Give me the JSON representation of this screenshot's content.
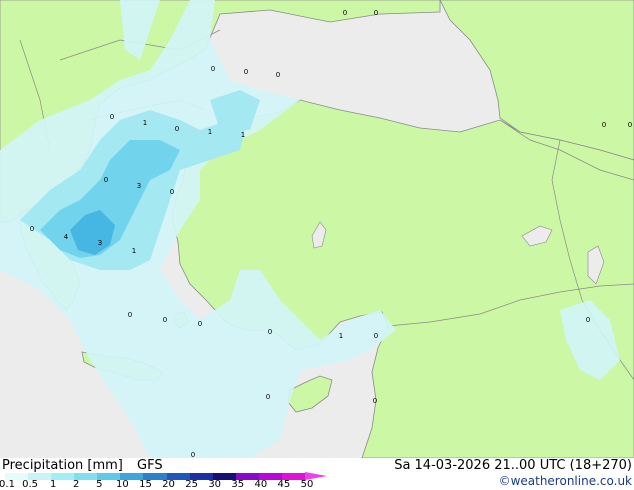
{
  "title": "Precipitation [mm]",
  "model": "GFS",
  "valid_time": "Sa 14-03-2026 21..00 UTC (18+270)",
  "credit": "©weatheronline.co.uk",
  "legend": {
    "ticks": [
      "0.1",
      "0.5",
      "1",
      "2",
      "5",
      "10",
      "15",
      "20",
      "25",
      "30",
      "35",
      "40",
      "45",
      "50"
    ],
    "colors": [
      "#e6fcfc",
      "#c8f4f8",
      "#a0eef6",
      "#7ee0f0",
      "#5ccbea",
      "#3aa6de",
      "#2a7fce",
      "#1e58be",
      "#1a30a8",
      "#14107a",
      "#8a08c8",
      "#b808d8",
      "#e010d8",
      "#f040e8"
    ]
  },
  "values": [
    "0",
    "0",
    "0",
    "0",
    "0",
    "0",
    "1",
    "0",
    "1",
    "1",
    "0",
    "0",
    "0",
    "3",
    "0",
    "0",
    "4",
    "3",
    "1",
    "0",
    "0",
    "0",
    "0",
    "1",
    "0",
    "0",
    "0",
    "0",
    "0",
    "0"
  ],
  "colors": {
    "land": "#ccf7a4",
    "sea": "#ececec",
    "rain_light": "#d2f4f8",
    "rain_mid": "#a4e8f2",
    "rain_heavy": "#72d4ec",
    "rain_max": "#46b6e2",
    "border": "#8a8a8a"
  }
}
